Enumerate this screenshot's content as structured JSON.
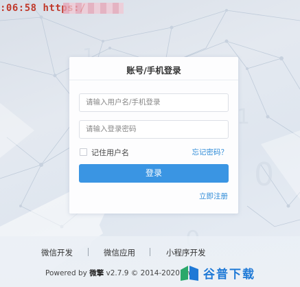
{
  "address_bar": {
    "text": ":06:58 https:/"
  },
  "login_card": {
    "title": "账号/手机登录",
    "username_placeholder": "请输入用户名/手机登录",
    "password_placeholder": "请输入登录密码",
    "remember_label": "记住用户名",
    "forgot_link": "忘记密码？",
    "login_button": "登录",
    "register_link": "立即注册"
  },
  "footer": {
    "links": [
      "微信开发",
      "微信应用",
      "小程序开发"
    ],
    "powered_prefix": "Powered by ",
    "powered_brand": "微擎",
    "powered_suffix": " v2.7.9 © 2014-2020 ww"
  },
  "watermark": {
    "text": "谷普下载"
  },
  "colors": {
    "accent": "#3a95e3",
    "link": "#2f8cd8",
    "address_red": "#c0392b",
    "watermark_blue": "#1e79d6"
  }
}
